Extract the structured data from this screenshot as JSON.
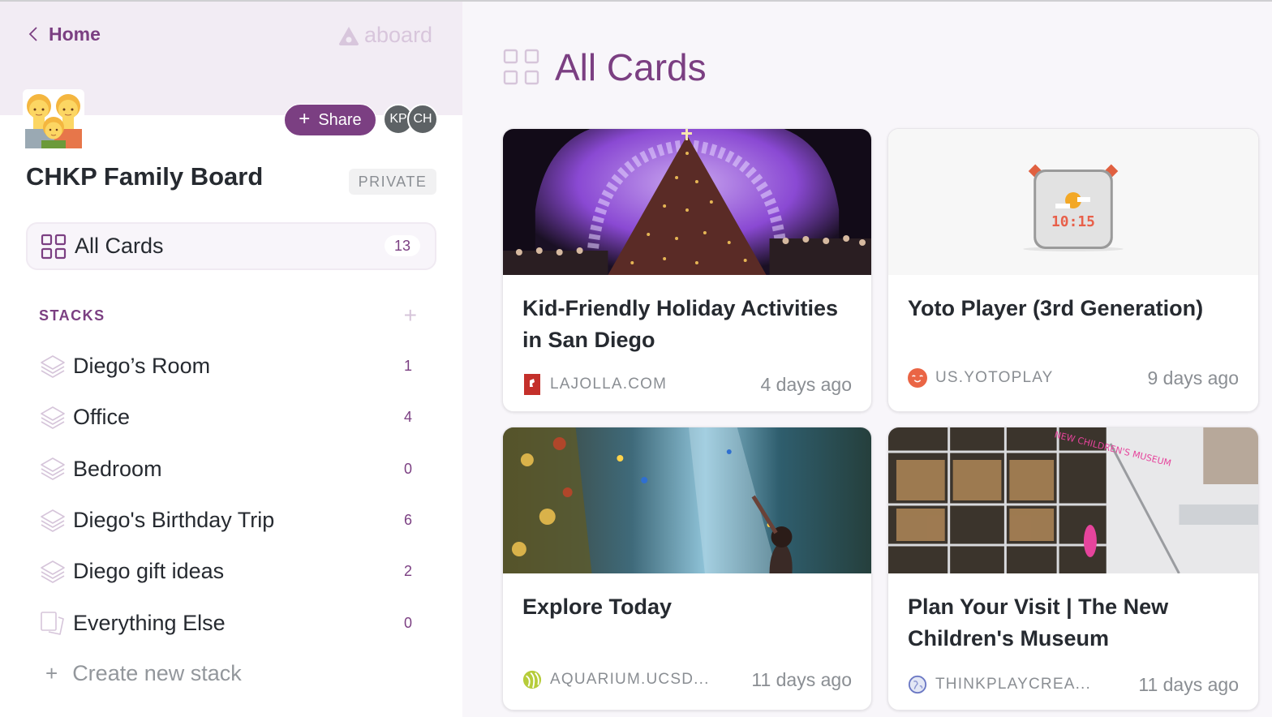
{
  "sidebar": {
    "home_label": "Home",
    "brand": "aboard",
    "share_label": "Share",
    "avatars": [
      "KP",
      "CH"
    ],
    "board_title": "CHKP Family Board",
    "visibility": "PRIVATE",
    "all_cards": {
      "label": "All Cards",
      "count": "13"
    },
    "stacks_title": "STACKS",
    "stacks": [
      {
        "label": "Diego’s Room",
        "count": "1",
        "icon": "stack-icon"
      },
      {
        "label": "Office",
        "count": "4",
        "icon": "stack-icon"
      },
      {
        "label": "Bedroom",
        "count": "0",
        "icon": "stack-icon"
      },
      {
        "label": "Diego's Birthday Trip",
        "count": "6",
        "icon": "stack-icon"
      },
      {
        "label": "Diego gift ideas",
        "count": "2",
        "icon": "stack-icon"
      },
      {
        "label": "Everything Else",
        "count": "0",
        "icon": "loose-cards-icon"
      }
    ],
    "create_stack_label": "Create new stack"
  },
  "main": {
    "page_title": "All Cards",
    "cards": [
      {
        "title": "Kid-Friendly Holiday Activities in San Diego",
        "source": "LAJOLLA.COM",
        "time": "4 days ago",
        "image": "holiday-tree-photo"
      },
      {
        "title": "Yoto Player (3rd Generation)",
        "source": "US.YOTOPLAY",
        "time": "9 days ago",
        "image": "yoto-player-photo"
      },
      {
        "title": "Explore Today",
        "source": "AQUARIUM.UCSD...",
        "time": "11 days ago",
        "image": "aquarium-photo"
      },
      {
        "title": "Plan Your Visit | The New Children's Museum",
        "source": "THINKPLAYCREA...",
        "time": "11 days ago",
        "image": "museum-photo"
      }
    ]
  },
  "colors": {
    "accent": "#7b3f82",
    "header_bg": "#f2ecf4",
    "avatar_bg": "#5d6265",
    "icon_light": "#d6c5da"
  }
}
